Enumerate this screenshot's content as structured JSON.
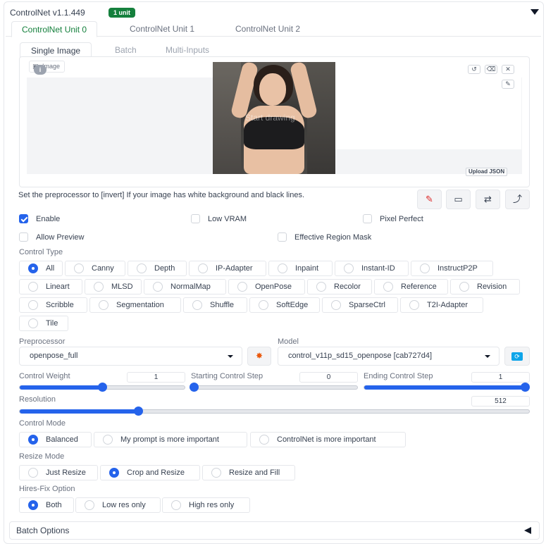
{
  "header": {
    "title": "ControlNet v1.1.449",
    "badge": "1 unit"
  },
  "unit_tabs": [
    "ControlNet Unit 0",
    "ControlNet Unit 1",
    "ControlNet Unit 2"
  ],
  "image_tabs": [
    "Single Image",
    "Batch",
    "Multi-Inputs"
  ],
  "image_panel": {
    "chip_label": "Image",
    "info_glyph": "i",
    "overlay_text": "Start drawing",
    "upload_json": "Upload JSON",
    "tools": [
      "undo-icon",
      "erase-icon",
      "close-icon",
      "brush-icon"
    ]
  },
  "hint": "Set the preprocessor to [invert] If your image has white background and black lines.",
  "action_buttons": [
    "edit-icon",
    "camera-icon",
    "swap-icon",
    "send-dimensions-icon"
  ],
  "checkboxes": {
    "enable": {
      "label": "Enable",
      "checked": true
    },
    "low_vram": {
      "label": "Low VRAM",
      "checked": false
    },
    "pixel_perfect": {
      "label": "Pixel Perfect",
      "checked": false
    },
    "allow_preview": {
      "label": "Allow Preview",
      "checked": false
    },
    "effective_region_mask": {
      "label": "Effective Region Mask",
      "checked": false
    }
  },
  "control_type": {
    "label": "Control Type",
    "options": [
      "All",
      "Canny",
      "Depth",
      "IP-Adapter",
      "Inpaint",
      "Instant-ID",
      "InstructP2P",
      "Lineart",
      "MLSD",
      "NormalMap",
      "OpenPose",
      "Recolor",
      "Reference",
      "Revision",
      "Scribble",
      "Segmentation",
      "Shuffle",
      "SoftEdge",
      "SparseCtrl",
      "T2I-Adapter",
      "Tile"
    ],
    "selected": "All"
  },
  "preprocessor": {
    "label": "Preprocessor",
    "value": "openpose_full",
    "run_icon": "explosion-icon"
  },
  "model": {
    "label": "Model",
    "value": "control_v11p_sd15_openpose [cab727d4]",
    "refresh_icon": "refresh-icon"
  },
  "sliders": {
    "control_weight": {
      "label": "Control Weight",
      "value": "1",
      "fraction": 0.5
    },
    "starting_step": {
      "label": "Starting Control Step",
      "value": "0",
      "fraction": 0.0
    },
    "ending_step": {
      "label": "Ending Control Step",
      "value": "1",
      "fraction": 1.0
    },
    "resolution": {
      "label": "Resolution",
      "value": "512",
      "fraction": 0.233
    }
  },
  "control_mode": {
    "label": "Control Mode",
    "options": [
      "Balanced",
      "My prompt is more important",
      "ControlNet is more important"
    ],
    "selected": "Balanced"
  },
  "resize_mode": {
    "label": "Resize Mode",
    "options": [
      "Just Resize",
      "Crop and Resize",
      "Resize and Fill"
    ],
    "selected": "Crop and Resize"
  },
  "hires_fix": {
    "label": "Hires-Fix Option",
    "options": [
      "Both",
      "Low res only",
      "High res only"
    ],
    "selected": "Both"
  },
  "batch_options": {
    "label": "Batch Options"
  },
  "colors": {
    "accent": "#2563eb",
    "badge": "#15803d",
    "active_tab": "#15803d"
  }
}
